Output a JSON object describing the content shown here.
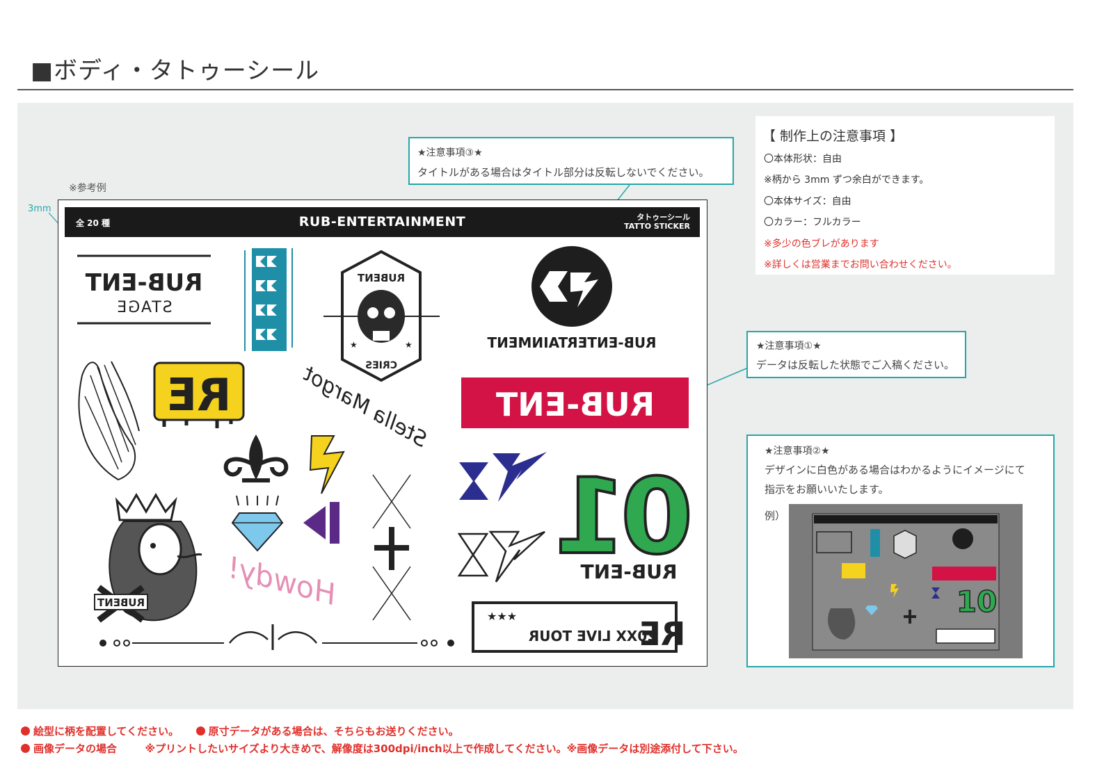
{
  "page": {
    "title": "■ボディ・タトゥーシール"
  },
  "sample": {
    "reference_label": "※参考例",
    "margin_label": "3mm",
    "bar": {
      "count": "全 20 種",
      "brand": "RUB-ENTERTAINMENT",
      "type_jp": "タトゥーシール",
      "type_en": "TATTO STICKER"
    },
    "stickers": {
      "stage_line1": "RUB-ENT",
      "stage_line2": "STAGE",
      "logo_text": "RUB-ENTERTAINMENT",
      "red_banner": "RUB-ENT",
      "number": "01",
      "number_caption": "RUB-ENT",
      "re_text": "RE",
      "skull_top": "RUBENT",
      "skull_bottom": "CRIES",
      "lion_banner": "RUBENT",
      "script_signature": "Stella Margot",
      "script_howdy": "Howdy!",
      "tour_stars": "★★★",
      "tour_text": "20XX LIVE TOUR",
      "tour_letters": "RE"
    }
  },
  "notes": {
    "note3": {
      "title": "★注意事項③★",
      "text": "タイトルがある場合はタイトル部分は反転しないでください。"
    },
    "note1": {
      "title": "★注意事項①★",
      "text": "データは反転した状態でご入稿ください。"
    },
    "note2": {
      "title": "★注意事項②★",
      "text_line1": "デザインに白色がある場合はわかるようにイメージにて",
      "text_line2": "指示をお願いいたします。",
      "example_label": "例）"
    },
    "production": {
      "heading": "【 制作上の注意事項 】",
      "lines": [
        "〇本体形状：自由",
        "※柄から 3mm ずつ余白ができます。",
        "〇本体サイズ：自由",
        "〇カラー：フルカラー"
      ],
      "red_lines": [
        "※多少の色ブレがあります",
        "※詳しくは営業までお問い合わせください。"
      ]
    }
  },
  "footer": {
    "line1_a": "絵型に柄を配置してください。",
    "line1_b": "原寸データがある場合は、そちらもお送りください。",
    "line2_a": "画像データの場合",
    "line2_b": "※プリントしたいサイズより大きめで、解像度は300dpi/inch以上で作成してください。※画像データは別途添付して下さい。"
  },
  "colors": {
    "accent_teal": "#23a7a7",
    "warning_red": "#e0302b",
    "banner_red": "#d31245",
    "teal_tile": "#1f8fa8",
    "navy": "#2b2e8f",
    "green": "#2fa84f",
    "yellow": "#f5d21e",
    "purple": "#5b2a86",
    "pink": "#e58fb4"
  }
}
